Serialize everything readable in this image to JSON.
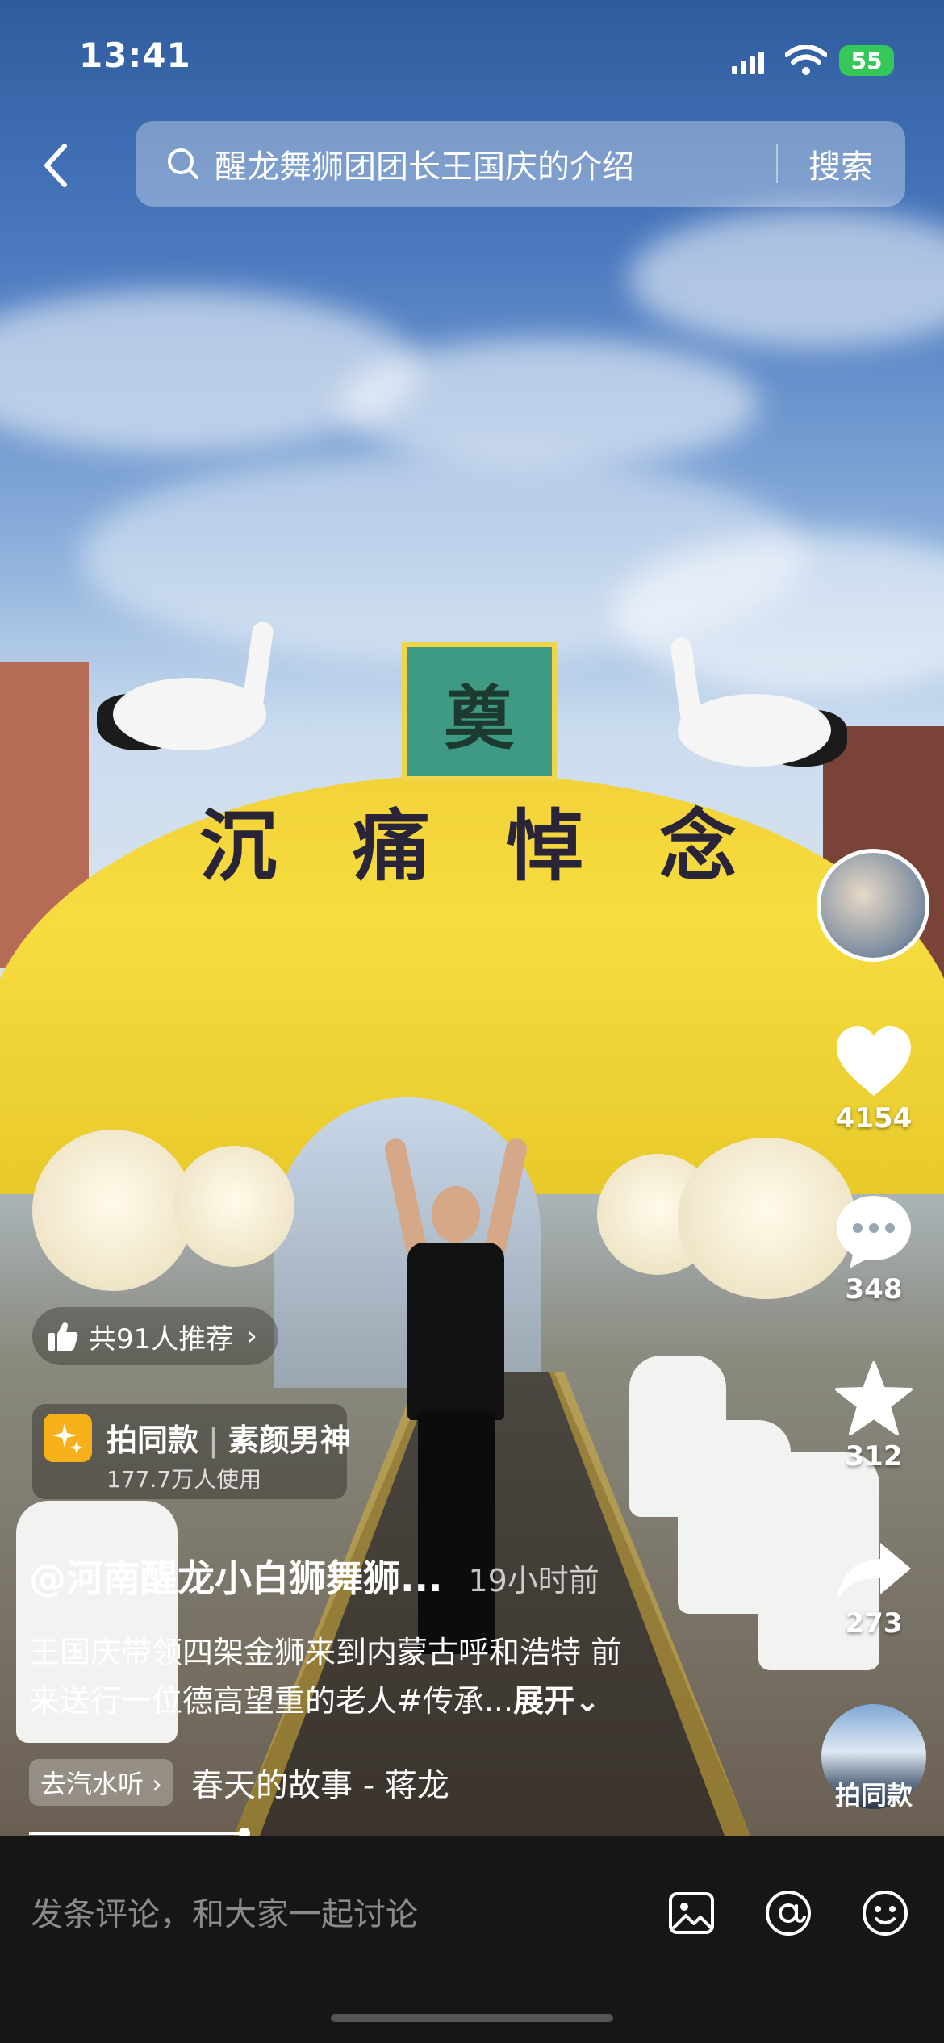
{
  "status_bar": {
    "time": "13:41",
    "battery": "55"
  },
  "search": {
    "query": "醒龙舞狮团团长王国庆的介绍",
    "button": "搜索"
  },
  "video_scene": {
    "banner_chars": [
      "沉",
      "痛",
      "悼",
      "念"
    ],
    "plaque_char": "奠"
  },
  "actions": {
    "likes": "4154",
    "comments": "348",
    "favorites": "312",
    "shares": "273",
    "music_label": "拍同款"
  },
  "recommend": {
    "text": "共91人推荐"
  },
  "same_style": {
    "title": "拍同款",
    "effect": "素颜男神",
    "users": "177.7万人使用"
  },
  "post": {
    "author": "@河南醒龙小白狮舞狮...",
    "time_ago": "19小时前",
    "description_line1": "王国庆带领四架金狮来到内蒙古呼和浩特 前",
    "description_line2": "来送行一位德高望重的老人#传承...",
    "expand": "展开"
  },
  "music": {
    "tag": "去汽水听 ›",
    "song": "春天的故事 - 蒋龙"
  },
  "comment_bar": {
    "placeholder": "发条评论，和大家一起讨论"
  },
  "icons": {
    "back": "back-chevron-icon",
    "search": "search-icon",
    "like": "heart-icon",
    "comment": "chat-bubble-icon",
    "favorite": "star-icon",
    "share": "share-arrow-icon",
    "image": "image-icon",
    "mention": "at-icon",
    "emoji": "emoji-icon"
  },
  "colors": {
    "battery": "#35c759",
    "badge": "#f6b01a",
    "bottom_bar": "#161616"
  }
}
